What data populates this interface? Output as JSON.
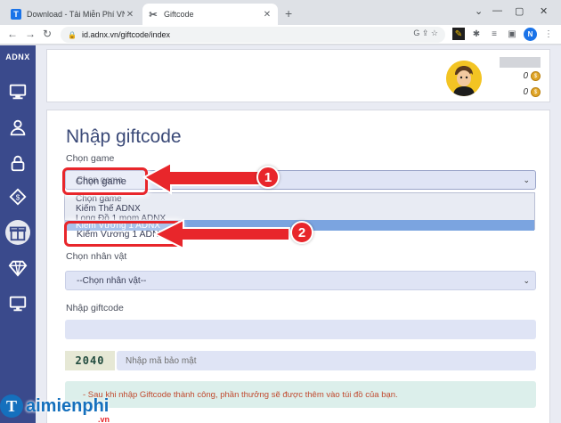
{
  "browser": {
    "tabs": [
      {
        "title": "Download - Tải Miễn Phí VN - Ph",
        "favicon": "T",
        "active": false
      },
      {
        "title": "Giftcode",
        "favicon": "✂",
        "active": true
      }
    ],
    "new_tab_label": "+",
    "window_controls": [
      "⌄",
      "—",
      "▢",
      "✕"
    ],
    "nav": {
      "back": "←",
      "forward": "→",
      "reload": "↻"
    },
    "address": "id.adnx.vn/giftcode/index",
    "omnibox_icons": "G  ⇪  ☆",
    "profile_initial": "N"
  },
  "site": {
    "logo": "ADNX",
    "balance": [
      "0",
      "0"
    ],
    "sidebar_icons": [
      "monitor-icon",
      "user-icon",
      "lock-icon",
      "tag-icon",
      "gift-icon",
      "diamond-icon",
      "desktop-icon"
    ]
  },
  "form": {
    "title": "Nhập giftcode",
    "game_label": "Chọn game",
    "game_select_value": "Chọn game",
    "game_options": [
      "Chọn game",
      "Kiếm Thế ADNX",
      "Long Đồ 1 mom ADNX",
      "Kiếm Vương 1 ADNX"
    ],
    "character_label": "Chọn nhân vật",
    "character_select_value": "--Chọn nhân vật--",
    "giftcode_label": "Nhập giftcode",
    "giftcode_placeholder": "",
    "captcha_code": "2040",
    "captcha_placeholder": "Nhập mã bảo mật",
    "notice": "- Sau khi nhập Giftcode thành công, phần thưởng sẽ được thêm vào túi đồ của bạn."
  },
  "annotations": {
    "step1": "1",
    "step2": "2",
    "highlight_1": "Chọn game",
    "highlight_2": "Kiếm Vương 1 ADNX"
  },
  "watermark": {
    "letter": "T",
    "text": "aimienphi",
    "suffix": ".vn"
  },
  "colors": {
    "sidebar": "#3a4a8c",
    "accent_red": "#e8262b",
    "title": "#3b4a78",
    "select_bg": "#dfe4f5",
    "option_highlight": "#7ba4e0"
  }
}
